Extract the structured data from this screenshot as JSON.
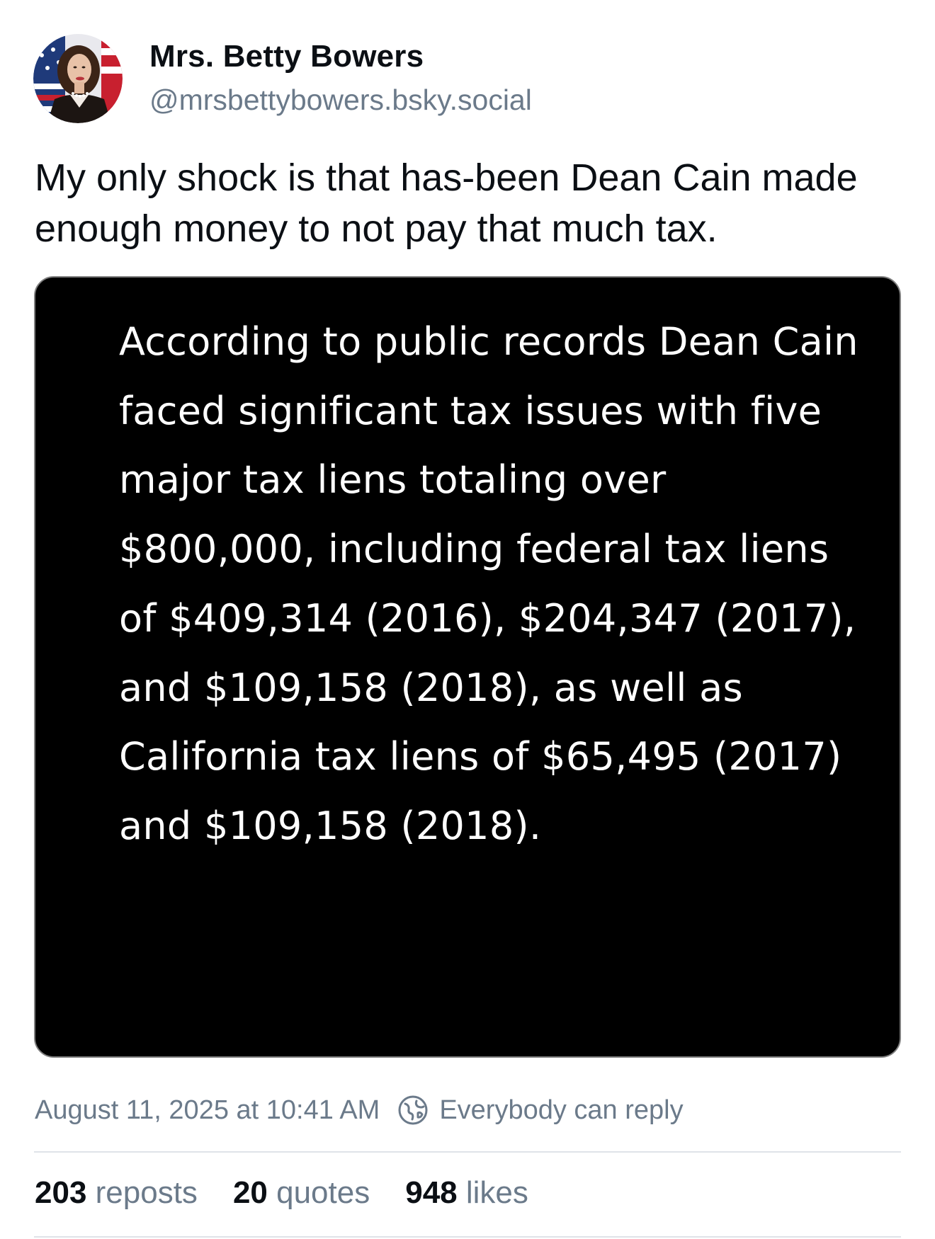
{
  "author": {
    "display_name": "Mrs. Betty Bowers",
    "handle": "@mrsbettybowers.bsky.social"
  },
  "post": {
    "text": "My only shock is that has-been Dean Cain made enough money to not pay that much tax.",
    "image_text": "According to public records Dean Cain faced significant tax issues with five major tax liens totaling over $800,000, including federal tax liens of $409,314 (2016), $204,347 (2017), and $109,158 (2018), as well as California tax liens of $65,495 (2017) and $109,158 (2018).",
    "timestamp": "August 11, 2025 at 10:41 AM",
    "reply_setting": "Everybody can reply",
    "reply_icon": "globe-icon"
  },
  "stats": {
    "reposts_count": "203",
    "reposts_label": "reposts",
    "quotes_count": "20",
    "quotes_label": "quotes",
    "likes_count": "948",
    "likes_label": "likes"
  },
  "colors": {
    "text_primary": "#0b0f14",
    "text_secondary": "#6b7a8a",
    "image_background": "#000000",
    "divider": "#dfe3e8"
  }
}
